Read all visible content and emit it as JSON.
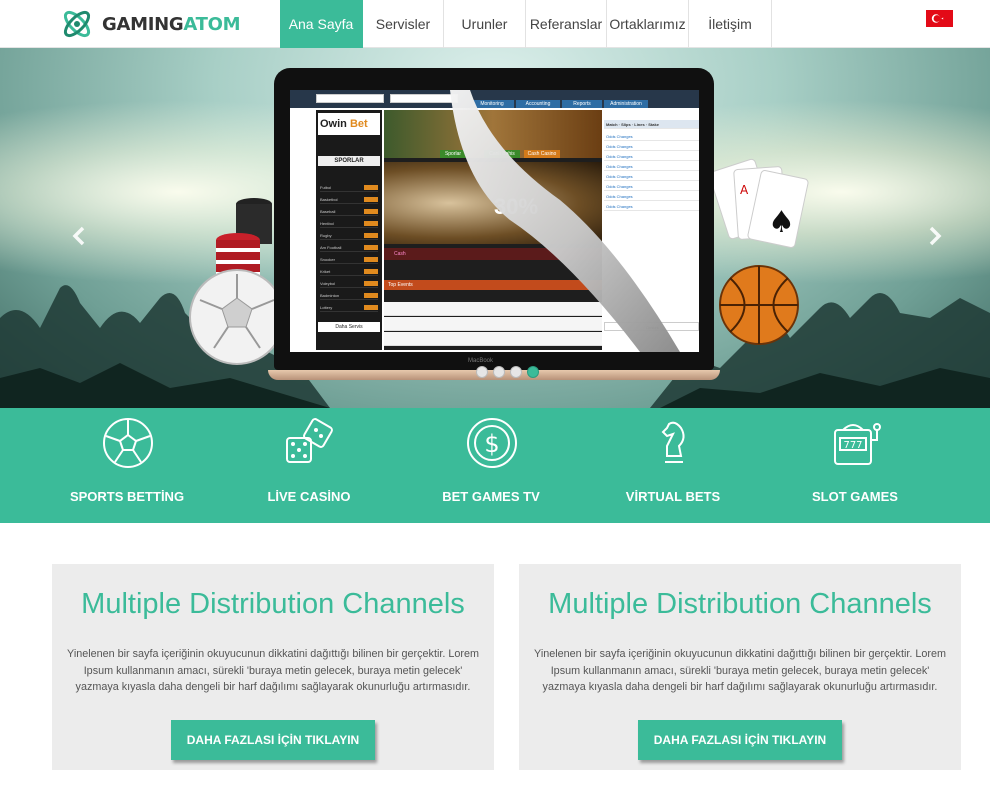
{
  "brand": {
    "name_part1": "GAMING",
    "name_part2": "ATOM",
    "accent_color": "#3bbb99"
  },
  "nav": {
    "items": [
      {
        "label": "Ana Sayfa",
        "active": true
      },
      {
        "label": "Servisler",
        "active": false
      },
      {
        "label": "Urunler",
        "active": false
      },
      {
        "label": "Referanslar",
        "active": false
      },
      {
        "label": "Ortaklarımız",
        "active": false
      },
      {
        "label": "İletişim",
        "active": false
      }
    ],
    "language_flag": "turkey-flag-icon"
  },
  "hero": {
    "slide_count": 4,
    "active_slide": 4,
    "prev_icon": "chevron-left-icon",
    "next_icon": "chevron-right-icon",
    "screen": {
      "site_logo_part1": "Owin",
      "site_logo_part2": "Bet",
      "sports_heading": "SPORLAR",
      "banner_tabs": [
        "Sporlar",
        "Canlı Bahis",
        "Cash Casino"
      ],
      "promo_text": "30%",
      "cash_label": "Cash",
      "top_events_label": "Top Events",
      "admin_tabs": [
        "Monitoring",
        "Accounting",
        "Reports",
        "Administration"
      ],
      "table_header": [
        "Match",
        "Slips",
        "Lines",
        "Stake"
      ],
      "odds_label": "Odds Changes",
      "support_label": "Destek",
      "sports": [
        "Futbol",
        "Basketbol",
        "Baseball",
        "Hentbol",
        "Rugby",
        "Am Football",
        "Snooker",
        "Kriket",
        "Voleybol",
        "Badminton",
        "Lottery"
      ],
      "all_sports_button": "Daha Servis",
      "device_label": "MacBook"
    }
  },
  "features": [
    {
      "label": "SPORTS BETTİNG",
      "icon": "soccer-ball-icon"
    },
    {
      "label": "LİVE CASİNO",
      "icon": "dice-icon"
    },
    {
      "label": "BET GAMES TV",
      "icon": "dollar-coin-icon"
    },
    {
      "label": "VİRTUAL BETS",
      "icon": "chess-knight-icon"
    },
    {
      "label": "SLOT GAMES",
      "icon": "slot-machine-icon"
    }
  ],
  "cards": [
    {
      "title": "Multiple Distribution Channels",
      "body": "Yinelenen bir sayfa içeriğinin okuyucunun dikkatini dağıttığı bilinen bir gerçektir. Lorem Ipsum kullanmanın amacı, sürekli 'buraya metin gelecek, buraya metin gelecek' yazmaya kıyasla daha dengeli bir harf dağılımı sağlayarak okunurluğu artırmasıdır.",
      "button": "DAHA FAZLASI İÇİN TIKLAYIN"
    },
    {
      "title": "Multiple Distribution Channels",
      "body": "Yinelenen bir sayfa içeriğinin okuyucunun dikkatini dağıttığı bilinen bir gerçektir. Lorem Ipsum kullanmanın amacı, sürekli 'buraya metin gelecek, buraya metin gelecek' yazmaya kıyasla daha dengeli bir harf dağılımı sağlayarak okunurluğu artırmasıdır.",
      "button": "DAHA FAZLASI İÇİN TIKLAYIN"
    }
  ]
}
